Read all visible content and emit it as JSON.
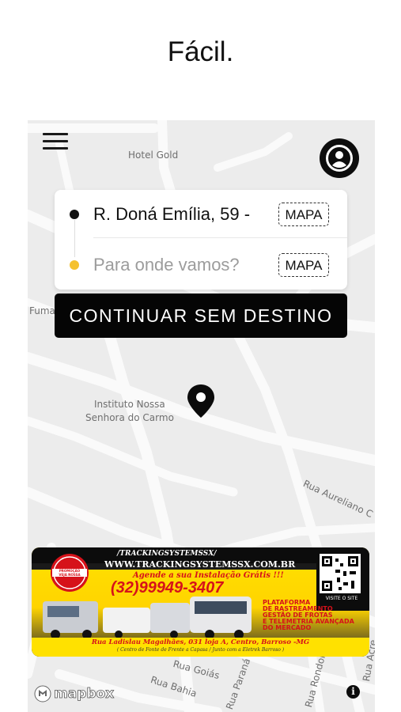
{
  "headline": "Fácil.",
  "map": {
    "labels": {
      "hotel_gold": "Hotel Gold",
      "fuma": "Fuma",
      "instituto_1": "Instituto Nossa",
      "instituto_2": "Senhora do Carmo",
      "rua_aureliano": "Rua Aureliano C",
      "rua_goias": "Rua Goiás",
      "rua_bahia": "Rua Bahia",
      "rua_parana": "Rua Paraná",
      "rua_rondon": "Rua Rondon",
      "rua_acre": "Rua Acre"
    },
    "attribution": "mapbox",
    "info_icon": "i"
  },
  "trip": {
    "origin": {
      "text": "R. Doná Emília, 59 -",
      "dot_color": "#111111",
      "map_button": "MAPA"
    },
    "destination": {
      "placeholder": "Para onde vamos?",
      "dot_color": "#f5c12e",
      "map_button": "MAPA"
    }
  },
  "continue_button": "CONTINUAR SEM DESTINO",
  "ad_banner": {
    "url_top": "/TRACKINGSYSTEMSSX/",
    "url": "WWW.TRACKINGSYSTEMSSX.COM.BR",
    "tagline": "Agende a sua Instalação Grátis !!!",
    "phone": "(32)99949-3407",
    "features": [
      "PLATAFORMA",
      "DE RASTREAMENTO",
      "GESTÃO DE FROTAS",
      "E TELEMETRIA AVANÇADA",
      "DO MERCADO"
    ],
    "badge": "PROMOÇÃO VEJA NOSSA",
    "qr_caption": "VISITE O SITE",
    "address": "Rua Ladislau Magalhães, 031 loja A, Centro, Barroso -MG",
    "address_note": "( Centro de Fonte de Frente a Capasa / Junto com a Eletrek Barroso )",
    "colors": {
      "yellow": "#ffe100",
      "red": "#d6121a"
    }
  },
  "icons": {
    "menu": "menu-icon",
    "profile": "user-avatar-icon",
    "pin": "location-pin-icon",
    "info": "info-icon"
  }
}
